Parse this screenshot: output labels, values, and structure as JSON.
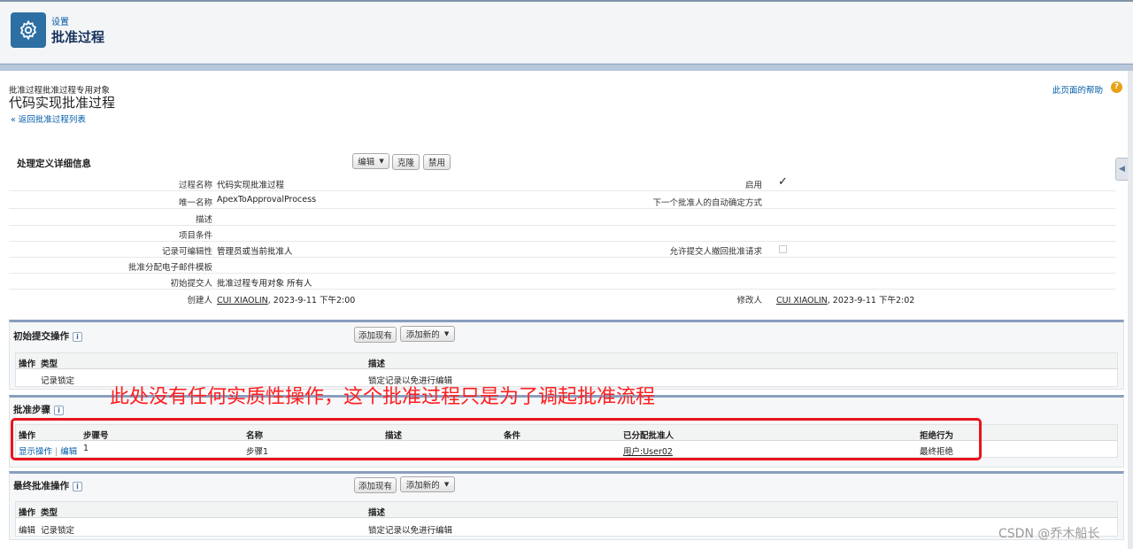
{
  "header": {
    "breadcrumb": "设置",
    "title": "批准过程"
  },
  "page": {
    "object_label": "批准过程批准过程专用对象",
    "title": "代码实现批准过程",
    "back_link": "« 返回批准过程列表",
    "help_link": "此页面的帮助",
    "help_icon": "?"
  },
  "detail": {
    "section_title": "处理定义详细信息",
    "buttons": {
      "edit": "编辑",
      "clone": "克隆",
      "disable": "禁用"
    },
    "fields": {
      "process_name_label": "过程名称",
      "process_name_value": "代码实现批准过程",
      "unique_name_label": "唯一名称",
      "unique_name_value": "ApexToApprovalProcess",
      "description_label": "描述",
      "entry_criteria_label": "项目条件",
      "record_editability_label": "记录可编辑性",
      "record_editability_value": "管理员或当前批准人",
      "email_template_label": "批准分配电子邮件模板",
      "initial_submitter_label": "初始提交人",
      "initial_submitter_value": "批准过程专用对象 所有人",
      "created_by_label": "创建人",
      "created_by_user": "CUI XIAOLIN",
      "created_by_date": ", 2023-9-11 下午2:00",
      "active_label": "启用",
      "active_check": "✓",
      "next_approver_label": "下一个批准人的自动确定方式",
      "allow_recall_label": "允许提交人撤回批准请求",
      "modified_by_label": "修改人",
      "modified_by_user": "CUI XIAOLIN",
      "modified_by_date": ", 2023-9-11 下午2:02"
    }
  },
  "initial_submission": {
    "title": "初始提交操作",
    "info_icon": "i",
    "btn_add_existing": "添加现有",
    "btn_add_new": "添加新的",
    "col_action": "操作",
    "col_type": "类型",
    "col_description": "描述",
    "row_type": "记录锁定",
    "row_description": "锁定记录以免进行编辑"
  },
  "approval_steps": {
    "title": "批准步骤",
    "info_icon": "i",
    "col_action": "操作",
    "col_step": "步骤号",
    "col_name": "名称",
    "col_description": "描述",
    "col_criteria": "条件",
    "col_approver": "已分配批准人",
    "col_reject": "拒绝行为",
    "row_show_actions": "显示操作",
    "row_separator": "|",
    "row_edit": "编辑",
    "row_step": "1",
    "row_name": "步骤1",
    "row_approver": "用户:User02",
    "row_reject": "最终拒绝"
  },
  "final_approval": {
    "title": "最终批准操作",
    "info_icon": "i",
    "btn_add_existing": "添加现有",
    "btn_add_new": "添加新的",
    "col_action": "操作",
    "col_type": "类型",
    "col_description": "描述",
    "row_edit": "编辑",
    "row_type": "记录锁定",
    "row_description": "锁定记录以免进行编辑"
  },
  "annotation": {
    "text": "此处没有任何实质性操作，这个批准过程只是为了调起批准流程",
    "color": "#ff1f1f"
  },
  "watermark": "CSDN @乔木船长",
  "colors": {
    "accent": "#2d6fa3",
    "link": "#015ba7",
    "section_border": "#8a9ebe",
    "annotation_box": "#e8141c"
  }
}
